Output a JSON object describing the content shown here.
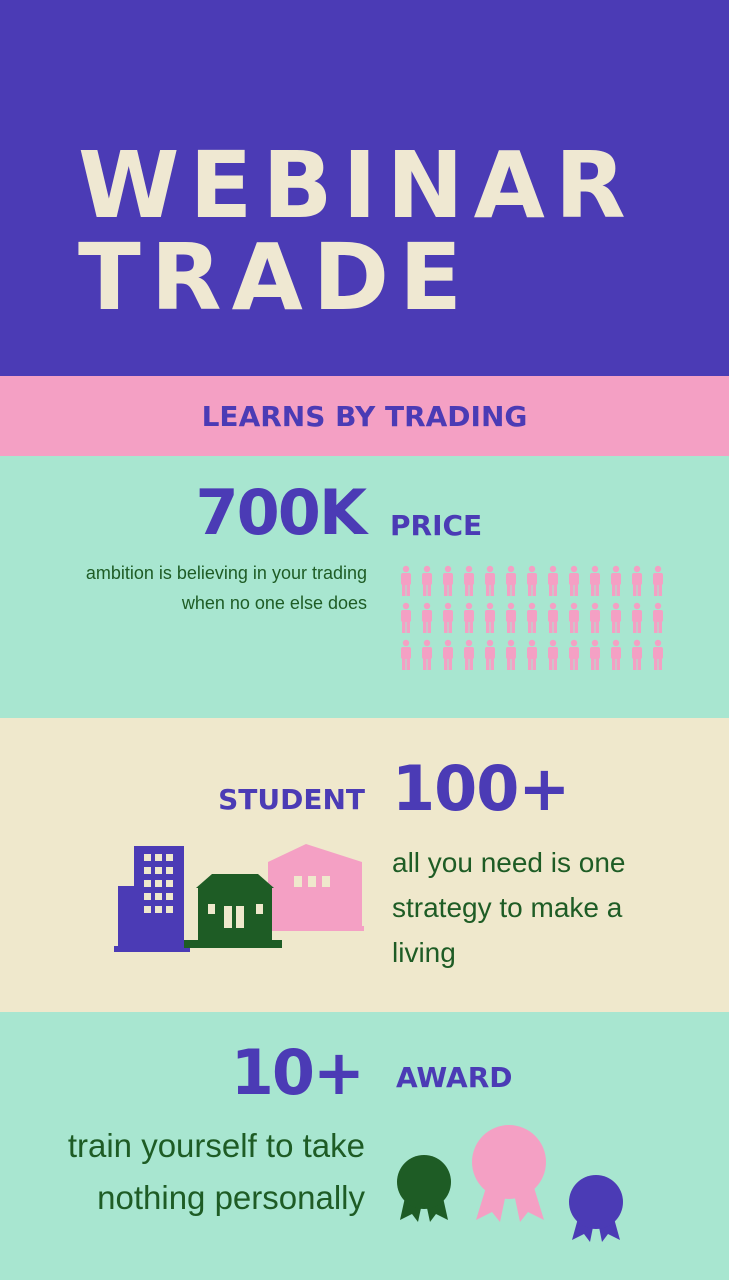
{
  "hero": {
    "line1": "WEBINAR",
    "line2": "TRADE"
  },
  "band": {
    "text": "LEARNS BY TRADING"
  },
  "price_section": {
    "stat": "700K",
    "label": "PRICE",
    "description": "ambition is believing in your trading when no one else does"
  },
  "student_section": {
    "label": "STUDENT",
    "stat": "100+",
    "description": "all you need is one strategy to make a living"
  },
  "award_section": {
    "stat": "10+",
    "label": "AWARD",
    "description": "train yourself to take nothing personally"
  },
  "icons": {
    "people": "person-icon",
    "buildings": [
      "office-building-icon",
      "house-icon",
      "warehouse-icon"
    ],
    "badges": [
      "award-ribbon-icon",
      "award-ribbon-icon",
      "award-ribbon-icon"
    ]
  },
  "colors": {
    "purple": "#4b3bb5",
    "pink": "#f4a0c4",
    "mint": "#a8e6d0",
    "cream": "#efe8cc",
    "green": "#1e5c25",
    "hero_text": "#efe8d2"
  }
}
